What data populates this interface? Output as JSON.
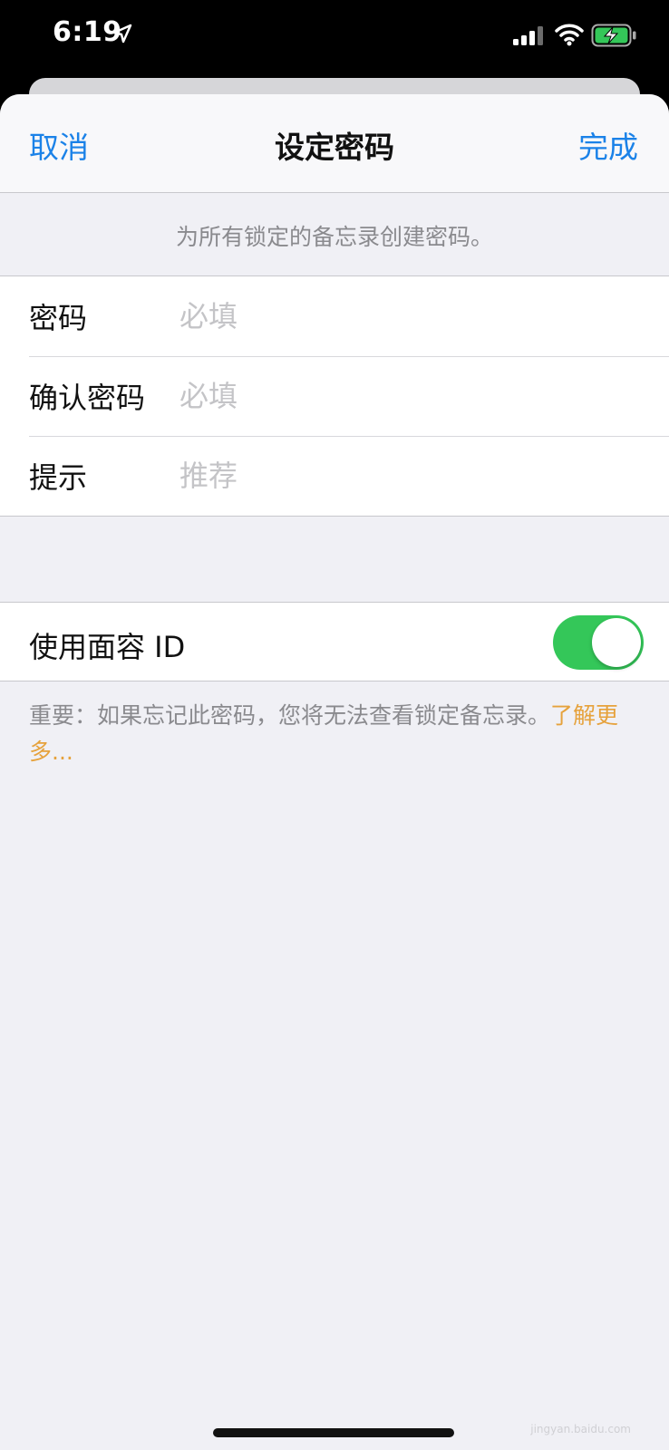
{
  "status": {
    "time": "6:19",
    "icons": [
      "location-arrow-icon",
      "cellular-signal-icon",
      "wifi-icon",
      "battery-charging-icon"
    ]
  },
  "nav": {
    "cancel_label": "取消",
    "title": "设定密码",
    "done_label": "完成"
  },
  "header": {
    "description": "为所有锁定的备忘录创建密码。"
  },
  "form": {
    "rows": [
      {
        "label": "密码",
        "placeholder": "必填"
      },
      {
        "label": "确认密码",
        "placeholder": "必填"
      },
      {
        "label": "提示",
        "placeholder": "推荐"
      }
    ]
  },
  "face_id": {
    "label": "使用面容 ID",
    "enabled": true
  },
  "footer": {
    "note": "重要：如果忘记此密码，您将无法查看锁定备忘录。",
    "link_label": "了解更多..."
  },
  "watermark": {
    "text": "jingyan.baidu.com"
  },
  "colors": {
    "accent": "#1b82e8",
    "toggle_on": "#34c759",
    "link": "#e6a23c",
    "background": "#f0f0f5"
  }
}
